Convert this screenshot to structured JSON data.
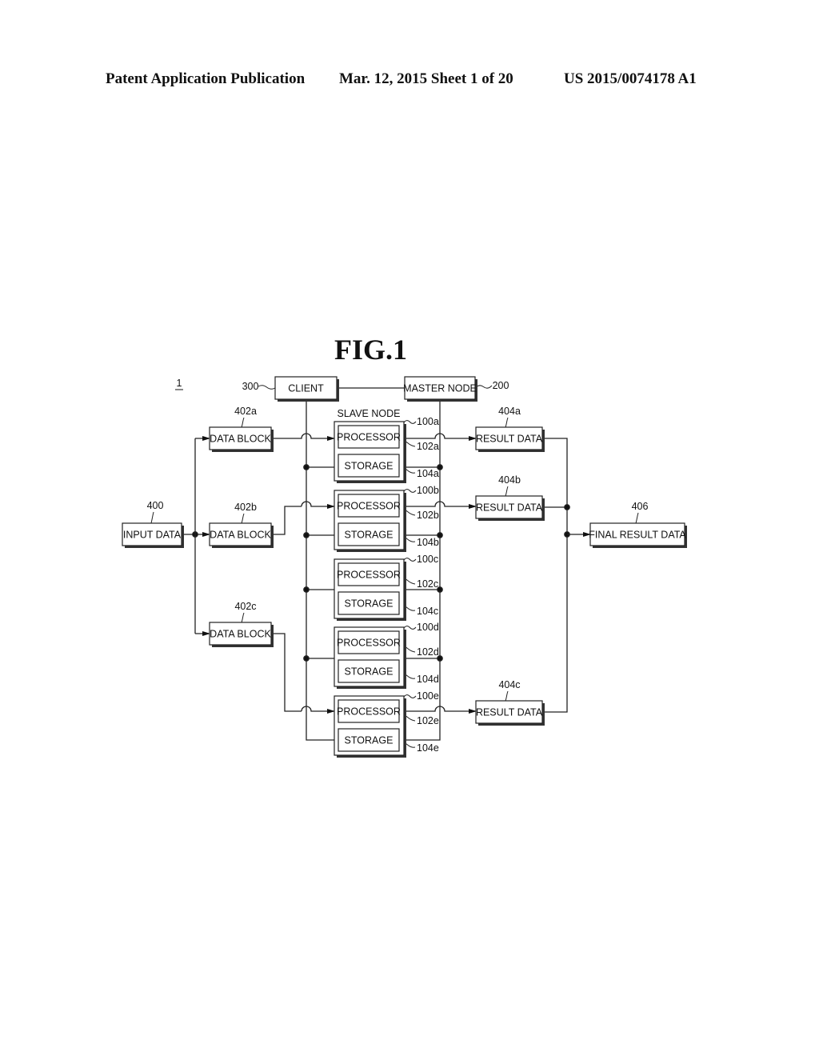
{
  "header": {
    "publication": "Patent Application Publication",
    "date_sheet": "Mar. 12, 2015  Sheet 1 of 20",
    "number": "US 2015/0074178 A1"
  },
  "figure": {
    "title": "FIG.1",
    "system_ref": "1",
    "client": {
      "label": "CLIENT",
      "ref": "300"
    },
    "master": {
      "label": "MASTER NODE",
      "ref": "200"
    },
    "slave_group_label": "SLAVE NODE",
    "input": {
      "label": "INPUT DATA",
      "ref": "400"
    },
    "data_blocks": [
      {
        "label": "DATA BLOCK",
        "ref": "402a"
      },
      {
        "label": "DATA BLOCK",
        "ref": "402b"
      },
      {
        "label": "DATA BLOCK",
        "ref": "402c"
      }
    ],
    "slave_nodes": [
      {
        "ref": "100a",
        "processor": "PROCESSOR",
        "processor_ref": "102a",
        "storage": "STORAGE",
        "storage_ref": "104a"
      },
      {
        "ref": "100b",
        "processor": "PROCESSOR",
        "processor_ref": "102b",
        "storage": "STORAGE",
        "storage_ref": "104b"
      },
      {
        "ref": "100c",
        "processor": "PROCESSOR",
        "processor_ref": "102c",
        "storage": "STORAGE",
        "storage_ref": "104c"
      },
      {
        "ref": "100d",
        "processor": "PROCESSOR",
        "processor_ref": "102d",
        "storage": "STORAGE",
        "storage_ref": "104d"
      },
      {
        "ref": "100e",
        "processor": "PROCESSOR",
        "processor_ref": "102e",
        "storage": "STORAGE",
        "storage_ref": "104e"
      }
    ],
    "results": [
      {
        "label": "RESULT DATA",
        "ref": "404a"
      },
      {
        "label": "RESULT DATA",
        "ref": "404b"
      },
      {
        "label": "RESULT DATA",
        "ref": "404c"
      }
    ],
    "final": {
      "label": "FINAL RESULT DATA",
      "ref": "406"
    }
  }
}
